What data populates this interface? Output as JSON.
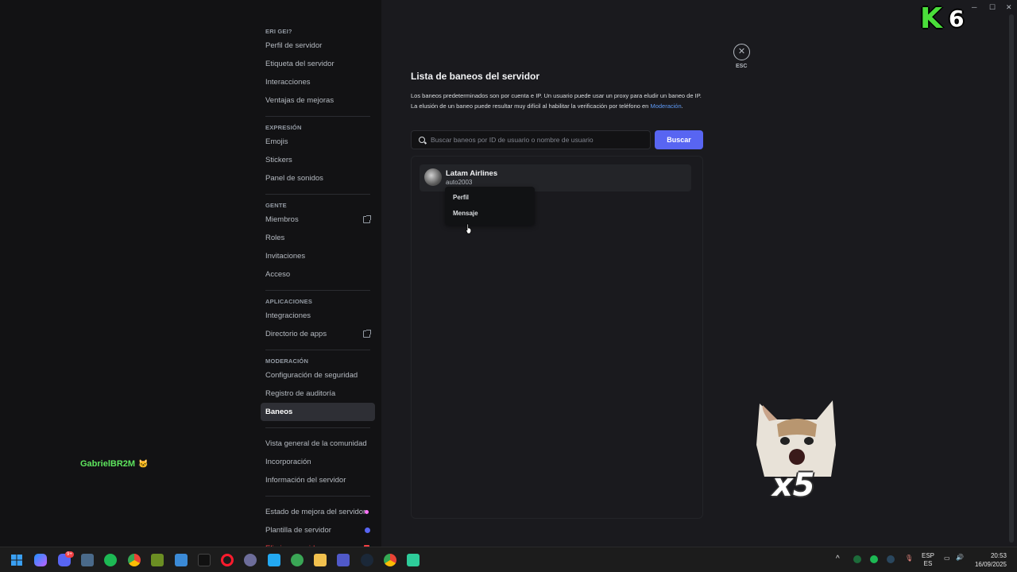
{
  "sidebar": {
    "sections": [
      {
        "header": "ERI GEI?",
        "items": [
          {
            "label": "Perfil de servidor"
          },
          {
            "label": "Etiqueta del servidor"
          },
          {
            "label": "Interacciones"
          },
          {
            "label": "Ventajas de mejoras"
          }
        ]
      },
      {
        "header": "EXPRESIÓN",
        "items": [
          {
            "label": "Emojis"
          },
          {
            "label": "Stickers"
          },
          {
            "label": "Panel de sonidos"
          }
        ]
      },
      {
        "header": "GENTE",
        "items": [
          {
            "label": "Miembros",
            "icon": "external-link-icon"
          },
          {
            "label": "Roles"
          },
          {
            "label": "Invitaciones"
          },
          {
            "label": "Acceso"
          }
        ]
      },
      {
        "header": "APLICACIONES",
        "items": [
          {
            "label": "Integraciones"
          },
          {
            "label": "Directorio de apps",
            "icon": "external-link-icon"
          }
        ]
      },
      {
        "header": "MODERACIÓN",
        "items": [
          {
            "label": "Configuración de seguridad"
          },
          {
            "label": "Registro de auditoría"
          },
          {
            "label": "Baneos",
            "active": true
          }
        ]
      },
      {
        "header": "",
        "items": [
          {
            "label": "Vista general de la comunidad"
          },
          {
            "label": "Incorporación"
          },
          {
            "label": "Información del servidor"
          }
        ]
      },
      {
        "header": "",
        "items": [
          {
            "label": "Estado de mejora del servidor",
            "icon": "boost-icon"
          },
          {
            "label": "Plantilla de servidor",
            "icon": "dot-icon"
          },
          {
            "label": "Eliminar servidor",
            "icon": "trash-icon",
            "danger": true
          }
        ]
      }
    ]
  },
  "overlay": {
    "username": "GabrielBR2M",
    "k6": {
      "letter": "K",
      "number": "6"
    },
    "multiplier": "x5"
  },
  "main": {
    "title": "Lista de baneos del servidor",
    "description": "Los baneos predeterminados son por cuenta e IP. Un usuario puede usar un proxy para eludir un baneo de IP. La elusión de un baneo puede resultar muy difícil al habilitar la verificación por teléfono en",
    "description_link": "Moderación",
    "description_end": ".",
    "search": {
      "placeholder": "Buscar baneos por ID de usuario o nombre de usuario",
      "value": ""
    },
    "search_button": "Buscar",
    "bans": [
      {
        "name": "Latam Airlines",
        "username": "auto2003"
      }
    ],
    "context_menu": [
      "Perfil",
      "Mensaje"
    ],
    "close_label": "ESC"
  },
  "taskbar": {
    "apps": [
      "windows-start",
      "copilot",
      "discord",
      "file-explorer-alt",
      "spotify",
      "chrome",
      "app",
      "app2",
      "tiktok",
      "opera",
      "app3",
      "vscode",
      "app4",
      "folder",
      "teams",
      "steam",
      "chrome-alt",
      "app5"
    ],
    "discord_badge": "9+",
    "tray": {
      "lang_top": "ESP",
      "lang_bottom": "ES"
    },
    "time": "20:53",
    "date": "16/09/2025"
  },
  "colors": {
    "accent": "#5865f2",
    "danger": "#f23f43",
    "link": "#5e9af6",
    "username": "#5ee65e"
  }
}
